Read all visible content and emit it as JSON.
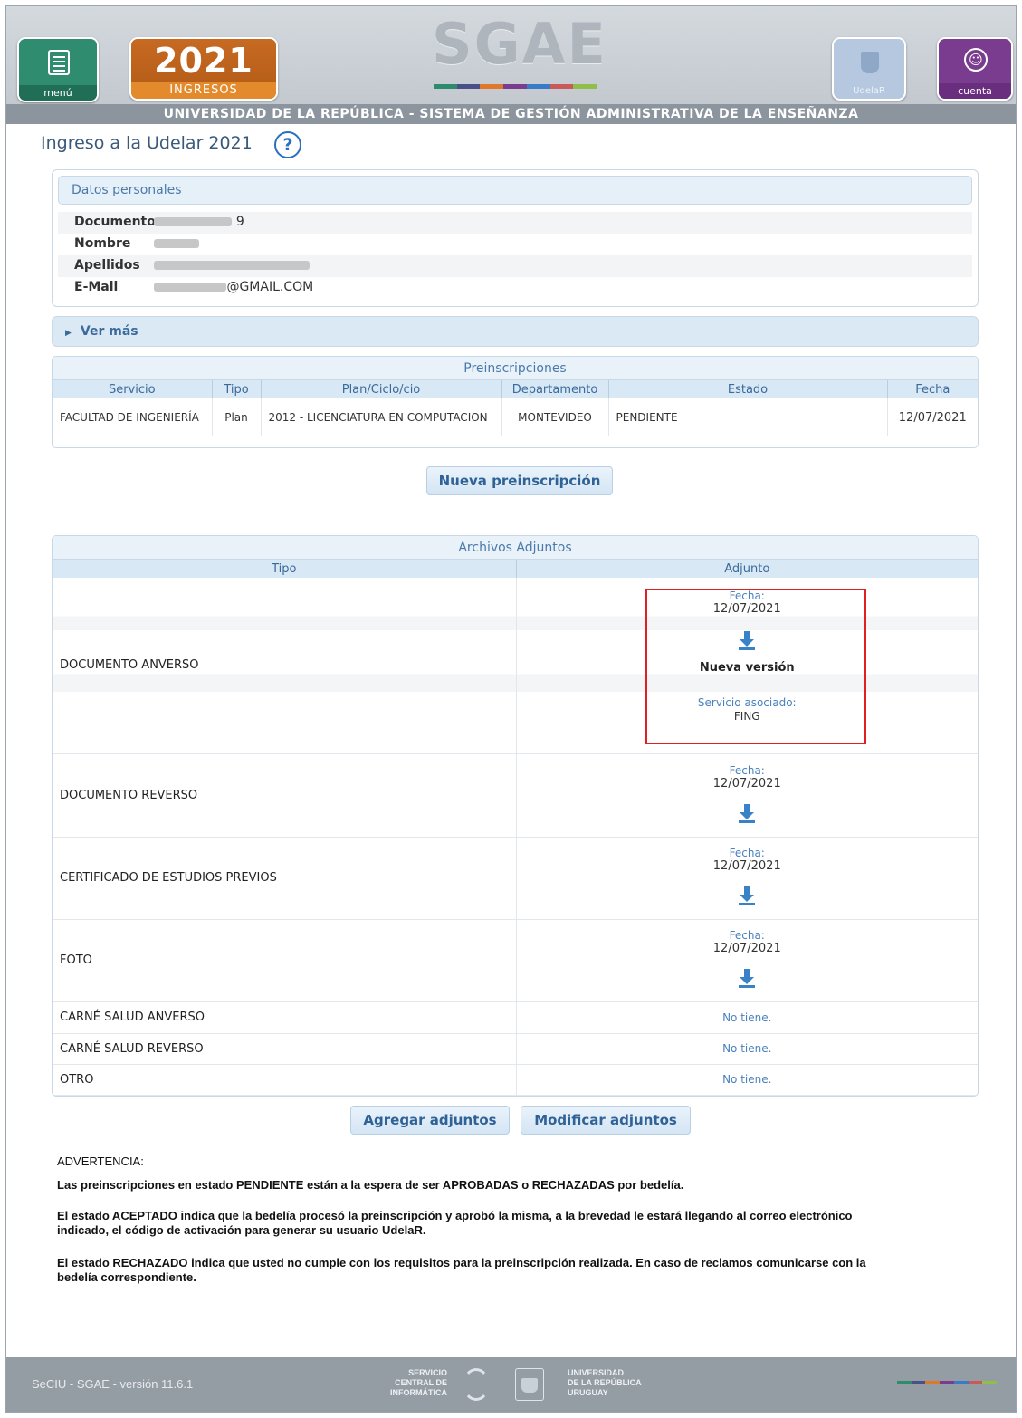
{
  "header": {
    "menu_label": "menú",
    "year": "2021",
    "year_sub": "INGRESOS",
    "logo": "SGAE",
    "udelar_label": "UdelaR",
    "cuenta_label": "cuenta",
    "banner": "UNIVERSIDAD DE LA REPÚBLICA - SISTEMA DE GESTIÓN ADMINISTRATIVA DE LA ENSEÑANZA",
    "logo_colors": [
      "#2e8b6d",
      "#4a4f87",
      "#e0782a",
      "#7a3c8e",
      "#3a7bc8",
      "#c95a5a",
      "#8fbf4a"
    ]
  },
  "page": {
    "title": "Ingreso a la Udelar 2021",
    "help_glyph": "?"
  },
  "personal": {
    "heading": "Datos personales",
    "fields": [
      {
        "label": "Documento",
        "value_visible": "9"
      },
      {
        "label": "Nombre",
        "value_visible": ""
      },
      {
        "label": "Apellidos",
        "value_visible": ""
      },
      {
        "label": "E-Mail",
        "value_visible": "@GMAIL.COM"
      }
    ]
  },
  "ver_mas": "Ver más",
  "preinscripciones": {
    "caption": "Preinscripciones",
    "headers": [
      "Servicio",
      "Tipo",
      "Plan/Ciclo/cio",
      "Departamento",
      "Estado",
      "Fecha"
    ],
    "rows": [
      [
        "FACULTAD DE INGENIERÍA",
        "Plan",
        "2012 - LICENCIATURA EN COMPUTACION",
        "MONTEVIDEO",
        "PENDIENTE",
        "12/07/2021"
      ]
    ]
  },
  "buttons": {
    "nueva": "Nueva preinscripción",
    "agregar": "Agregar adjuntos",
    "modificar": "Modificar adjuntos"
  },
  "adjuntos": {
    "caption": "Archivos Adjuntos",
    "headers": [
      "Tipo",
      "Adjunto"
    ],
    "fecha_label": "Fecha:",
    "nueva_version": "Nueva versión",
    "servicio_label": "Servicio asociado:",
    "servicio_value": "FING",
    "no_tiene": "No tiene.",
    "rows": [
      {
        "tipo": "DOCUMENTO ANVERSO",
        "fecha": "12/07/2021"
      },
      {
        "tipo": "DOCUMENTO REVERSO",
        "fecha": "12/07/2021"
      },
      {
        "tipo": "CERTIFICADO DE ESTUDIOS PREVIOS",
        "fecha": "12/07/2021"
      },
      {
        "tipo": "FOTO",
        "fecha": "12/07/2021"
      },
      {
        "tipo": "CARNÉ SALUD ANVERSO"
      },
      {
        "tipo": "CARNÉ SALUD REVERSO"
      },
      {
        "tipo": "OTRO"
      }
    ]
  },
  "advertencia": {
    "title": "ADVERTENCIA:",
    "p1": "Las preinscripciones en estado PENDIENTE están a la espera de ser APROBADAS o RECHAZADAS por bedelía.",
    "p2a": "El estado ACEPTADO indica que la bedelía procesó la preinscripción y aprobó la misma, a la brevedad le estará llegando al correo electrónico",
    "p2b": "indicado, el código de activación para generar su usuario UdelaR.",
    "p3a": "El estado RECHAZADO indica que usted no cumple con los requisitos para la preinscripción realizada. En caso de reclamos comunicarse con la",
    "p3b": "bedelía correspondiente."
  },
  "footer": {
    "version": "SeCIU - SGAE - versión 11.6.1",
    "sci_1": "SERVICIO",
    "sci_2": "CENTRAL DE",
    "sci_3": "INFORMÁTICA",
    "ud_1": "UNIVERSIDAD",
    "ud_2": "DE LA REPÚBLICA",
    "ud_3": "URUGUAY"
  }
}
